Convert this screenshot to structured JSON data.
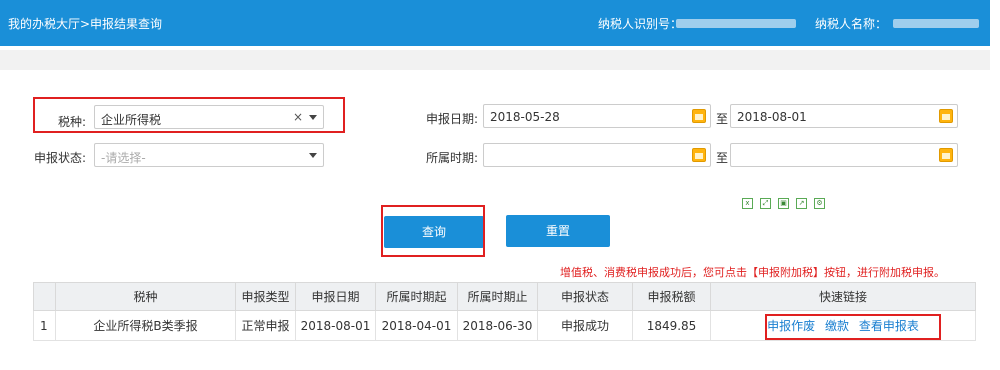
{
  "header": {
    "breadcrumb": "我的办税大厅>申报结果查询",
    "taxpayer_id_label": "纳税人识别号：",
    "taxpayer_name_label": "纳税人名称："
  },
  "form": {
    "tax_type_label": "税种:",
    "tax_type_value": "企业所得税",
    "tax_type_clear": "×",
    "status_label": "申报状态:",
    "status_placeholder": "-请选择-",
    "report_date_label": "申报日期:",
    "report_date_from": "2018-05-28",
    "report_date_to": "2018-08-01",
    "period_label": "所属时期:",
    "period_from": "",
    "period_to": "",
    "to_label": "至"
  },
  "buttons": {
    "query": "查询",
    "reset": "重置"
  },
  "toolbar_icons": [
    "excel-icon",
    "expand-icon",
    "print-icon",
    "export-icon",
    "settings-icon"
  ],
  "notice": "增值税、消费税申报成功后，您可点击【申报附加税】按钮，进行附加税申报。",
  "table": {
    "headers": [
      "",
      "税种",
      "申报类型",
      "申报日期",
      "所属时期起",
      "所属时期止",
      "申报状态",
      "申报税额",
      "快速链接"
    ],
    "rows": [
      {
        "index": "1",
        "tax_type": "企业所得税B类季报",
        "report_type": "正常申报",
        "report_date": "2018-08-01",
        "period_start": "2018-04-01",
        "period_end": "2018-06-30",
        "status": "申报成功",
        "amount": "1849.85",
        "links": [
          "申报作废",
          "缴款",
          "查看申报表"
        ]
      }
    ]
  },
  "colors": {
    "header_blue": "#1a8fd8",
    "highlight_red": "#e02020",
    "link_blue": "#1a7fd0"
  }
}
